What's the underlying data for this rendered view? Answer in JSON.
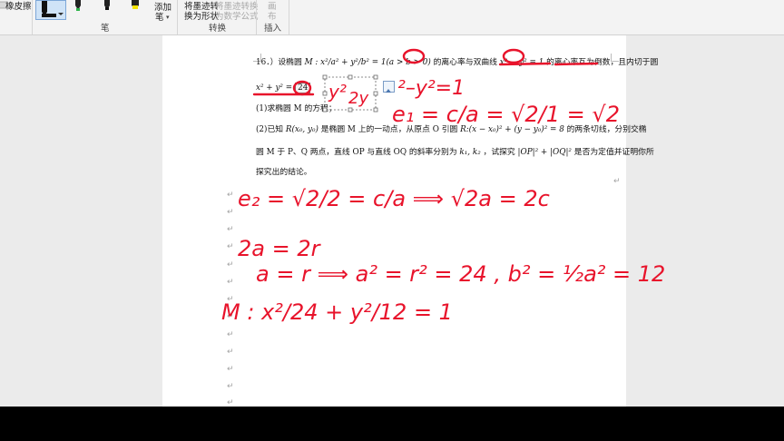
{
  "ribbon": {
    "eraser_label": "橡皮擦",
    "pens_group_label": "笔",
    "add_pen_label": "添加",
    "add_pen_sub": "笔",
    "ink_to_shape_line1": "将墨迹转",
    "ink_to_shape_line2": "换为形状",
    "ink_to_math_line1": "将墨迹转换",
    "ink_to_math_line2": "为数学公式",
    "convert_group_label": "转换",
    "canvas_line1": "画",
    "canvas_line2": "布",
    "insert_group_label": "插入"
  },
  "colors": {
    "ink": "#e8132b",
    "accent": "#1a5ea8",
    "pen_green": "#2db34a",
    "pen_yellow": "#f5e400"
  },
  "document": {
    "q_line1_a": "16．）设椭圆",
    "q_line1_b": "的离心率与双曲线",
    "q_line1_c": "的离心率互为倒数，且内切于圆",
    "q_line2_b": "24",
    "q_line3": "(1)求椭圆 M 的方程；",
    "q_line4_a": "(2)已知",
    "q_line4_b": "是椭圆 M 上的一动点，从原点 O 引圆",
    "q_line4_c": "的两条切线，分别交椭",
    "q_line5_a": "圆 M 于 P、Q 两点，直线 OP 与直线 OQ 的斜率分别为",
    "q_line5_b": "，试探究",
    "q_line5_c": "是否为定值并证明你所",
    "q_line6": "探究出的结论。"
  },
  "handwriting": {
    "top_eq": "²–y²=1",
    "e1_eq": "e₁ = c/a = √2/1 = √2",
    "e2_eq": "e₂ = √2/2 = c/a ⟹ √2a = 2c",
    "line_a": "2a = 2r",
    "line_b": "a = r ⟹ a² = r² = 24 ,  b² = ½a² = 12",
    "line_c": "M : x²/24 + y²/12 = 1"
  }
}
